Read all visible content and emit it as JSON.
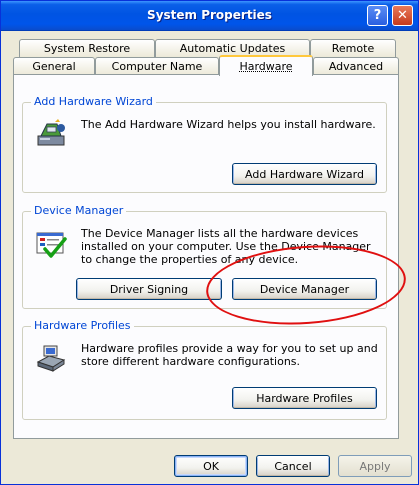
{
  "window": {
    "title": "System Properties",
    "help_glyph": "?",
    "close_glyph": "✕"
  },
  "tabs": {
    "back_row": [
      "System Restore",
      "Automatic Updates",
      "Remote"
    ],
    "front_row": [
      "General",
      "Computer Name",
      "Hardware",
      "Advanced"
    ],
    "active": "Hardware"
  },
  "groups": {
    "add_hardware": {
      "label": "Add Hardware Wizard",
      "text": "The Add Hardware Wizard helps you install hardware.",
      "button": "Add Hardware Wizard"
    },
    "device_manager": {
      "label": "Device Manager",
      "text": "The Device Manager lists all the hardware devices installed on your computer. Use the Device Manager to change the properties of any device.",
      "driver_button": "Driver Signing",
      "button": "Device Manager"
    },
    "hardware_profiles": {
      "label": "Hardware Profiles",
      "text": "Hardware profiles provide a way for you to set up and store different hardware configurations.",
      "button": "Hardware Profiles"
    }
  },
  "footer": {
    "ok": "OK",
    "cancel": "Cancel",
    "apply": "Apply"
  },
  "colors": {
    "titlebar": "#0054e3",
    "group_label": "#0046d5",
    "annotation": "#e01010",
    "tab_highlight": "#ffc83c"
  },
  "icons": {
    "add_hardware": "hardware-wizard-icon",
    "device_manager": "device-manager-icon",
    "hardware_profiles": "hardware-profiles-icon"
  }
}
